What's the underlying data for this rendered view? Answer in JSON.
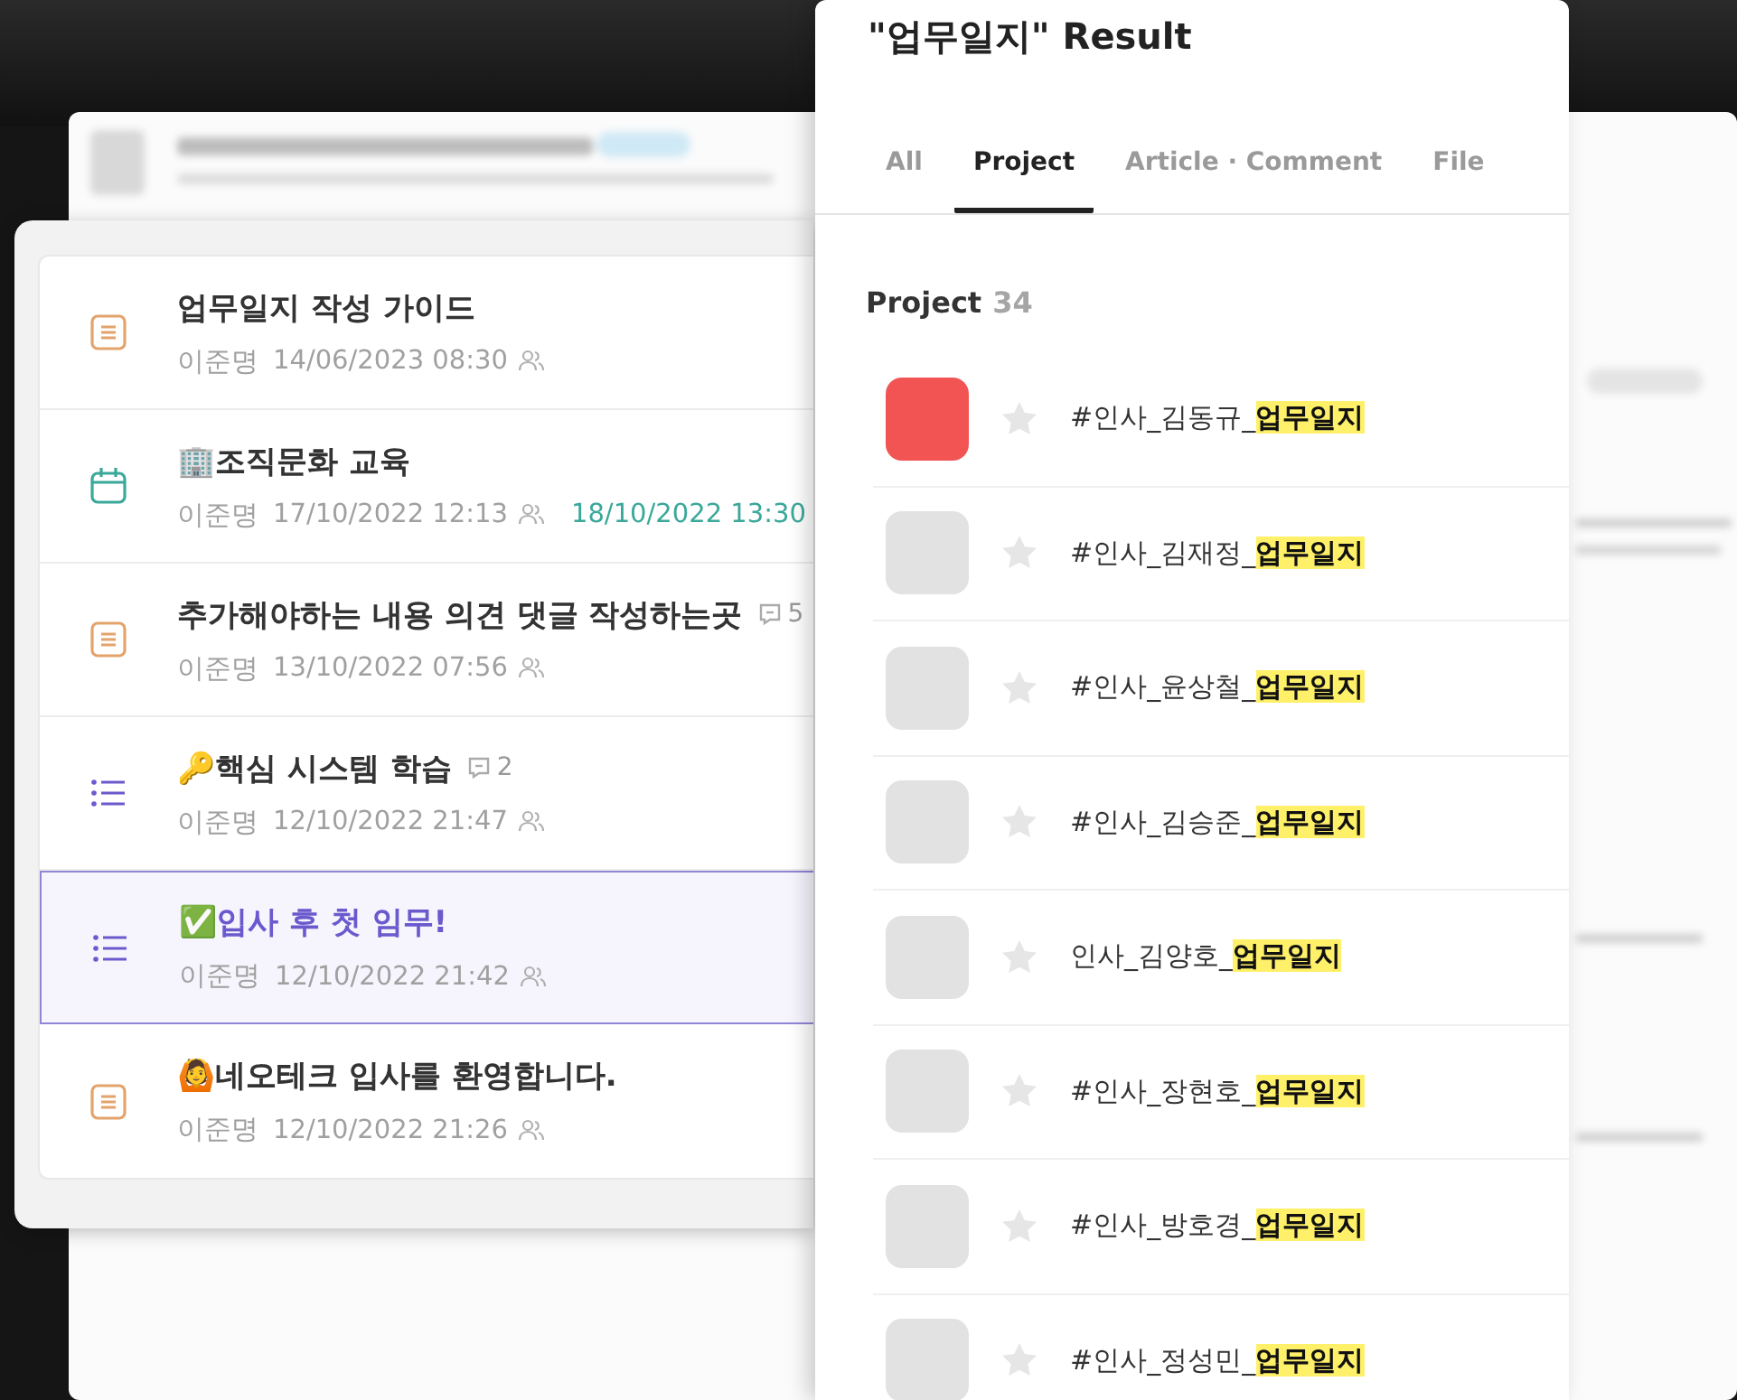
{
  "posts": [
    {
      "kind": "document",
      "title": "업무일지 작성 가이드",
      "author": "이준명",
      "date": "14/06/2023 08:30",
      "selected": false
    },
    {
      "kind": "event",
      "title": "🏢조직문화 교육",
      "author": "이준명",
      "date": "17/10/2022 12:13",
      "due": "18/10/2022 13:30",
      "selected": false
    },
    {
      "kind": "document",
      "title": "추가해야하는 내용 의견 댓글 작성하는곳",
      "comments": "5",
      "author": "이준명",
      "date": "13/10/2022 07:56",
      "selected": false
    },
    {
      "kind": "task",
      "title": "🔑핵심 시스템 학습",
      "comments": "2",
      "author": "이준명",
      "date": "12/10/2022 21:47",
      "selected": false
    },
    {
      "kind": "task",
      "title": "✅입사 후 첫 임무!",
      "author": "이준명",
      "date": "12/10/2022 21:42",
      "selected": true
    },
    {
      "kind": "document",
      "title": "🙆네오테크 입사를 환영합니다.",
      "author": "이준명",
      "date": "12/10/2022 21:26",
      "selected": false
    }
  ],
  "results": {
    "title": "\"업무일지\" Result",
    "tabs": [
      {
        "label": "All",
        "selected": false
      },
      {
        "label": "Project",
        "selected": true
      },
      {
        "label": "Article · Comment",
        "selected": false
      },
      {
        "label": "File",
        "selected": false
      }
    ],
    "section": {
      "label": "Project",
      "count": "34"
    },
    "projects": [
      {
        "name": "#인사_김동규_",
        "match": "업무일지",
        "color": "#f25454",
        "starred": false
      },
      {
        "name": "#인사_김재정_",
        "match": "업무일지",
        "color": "#e2e2e2",
        "starred": false
      },
      {
        "name": "#인사_윤상철_",
        "match": "업무일지",
        "color": "#e2e2e2",
        "starred": false
      },
      {
        "name": "#인사_김승준_",
        "match": "업무일지",
        "color": "#e2e2e2",
        "starred": false
      },
      {
        "name": "인사_김양호_",
        "match": "업무일지",
        "color": "#e2e2e2",
        "starred": false
      },
      {
        "name": "#인사_장현호_",
        "match": "업무일지",
        "color": "#e2e2e2",
        "starred": false
      },
      {
        "name": "#인사_방호경_",
        "match": "업무일지",
        "color": "#e2e2e2",
        "starred": false
      },
      {
        "name": "#인사_정성민_",
        "match": "업무일지",
        "color": "#e2e2e2",
        "starred": false
      }
    ]
  }
}
